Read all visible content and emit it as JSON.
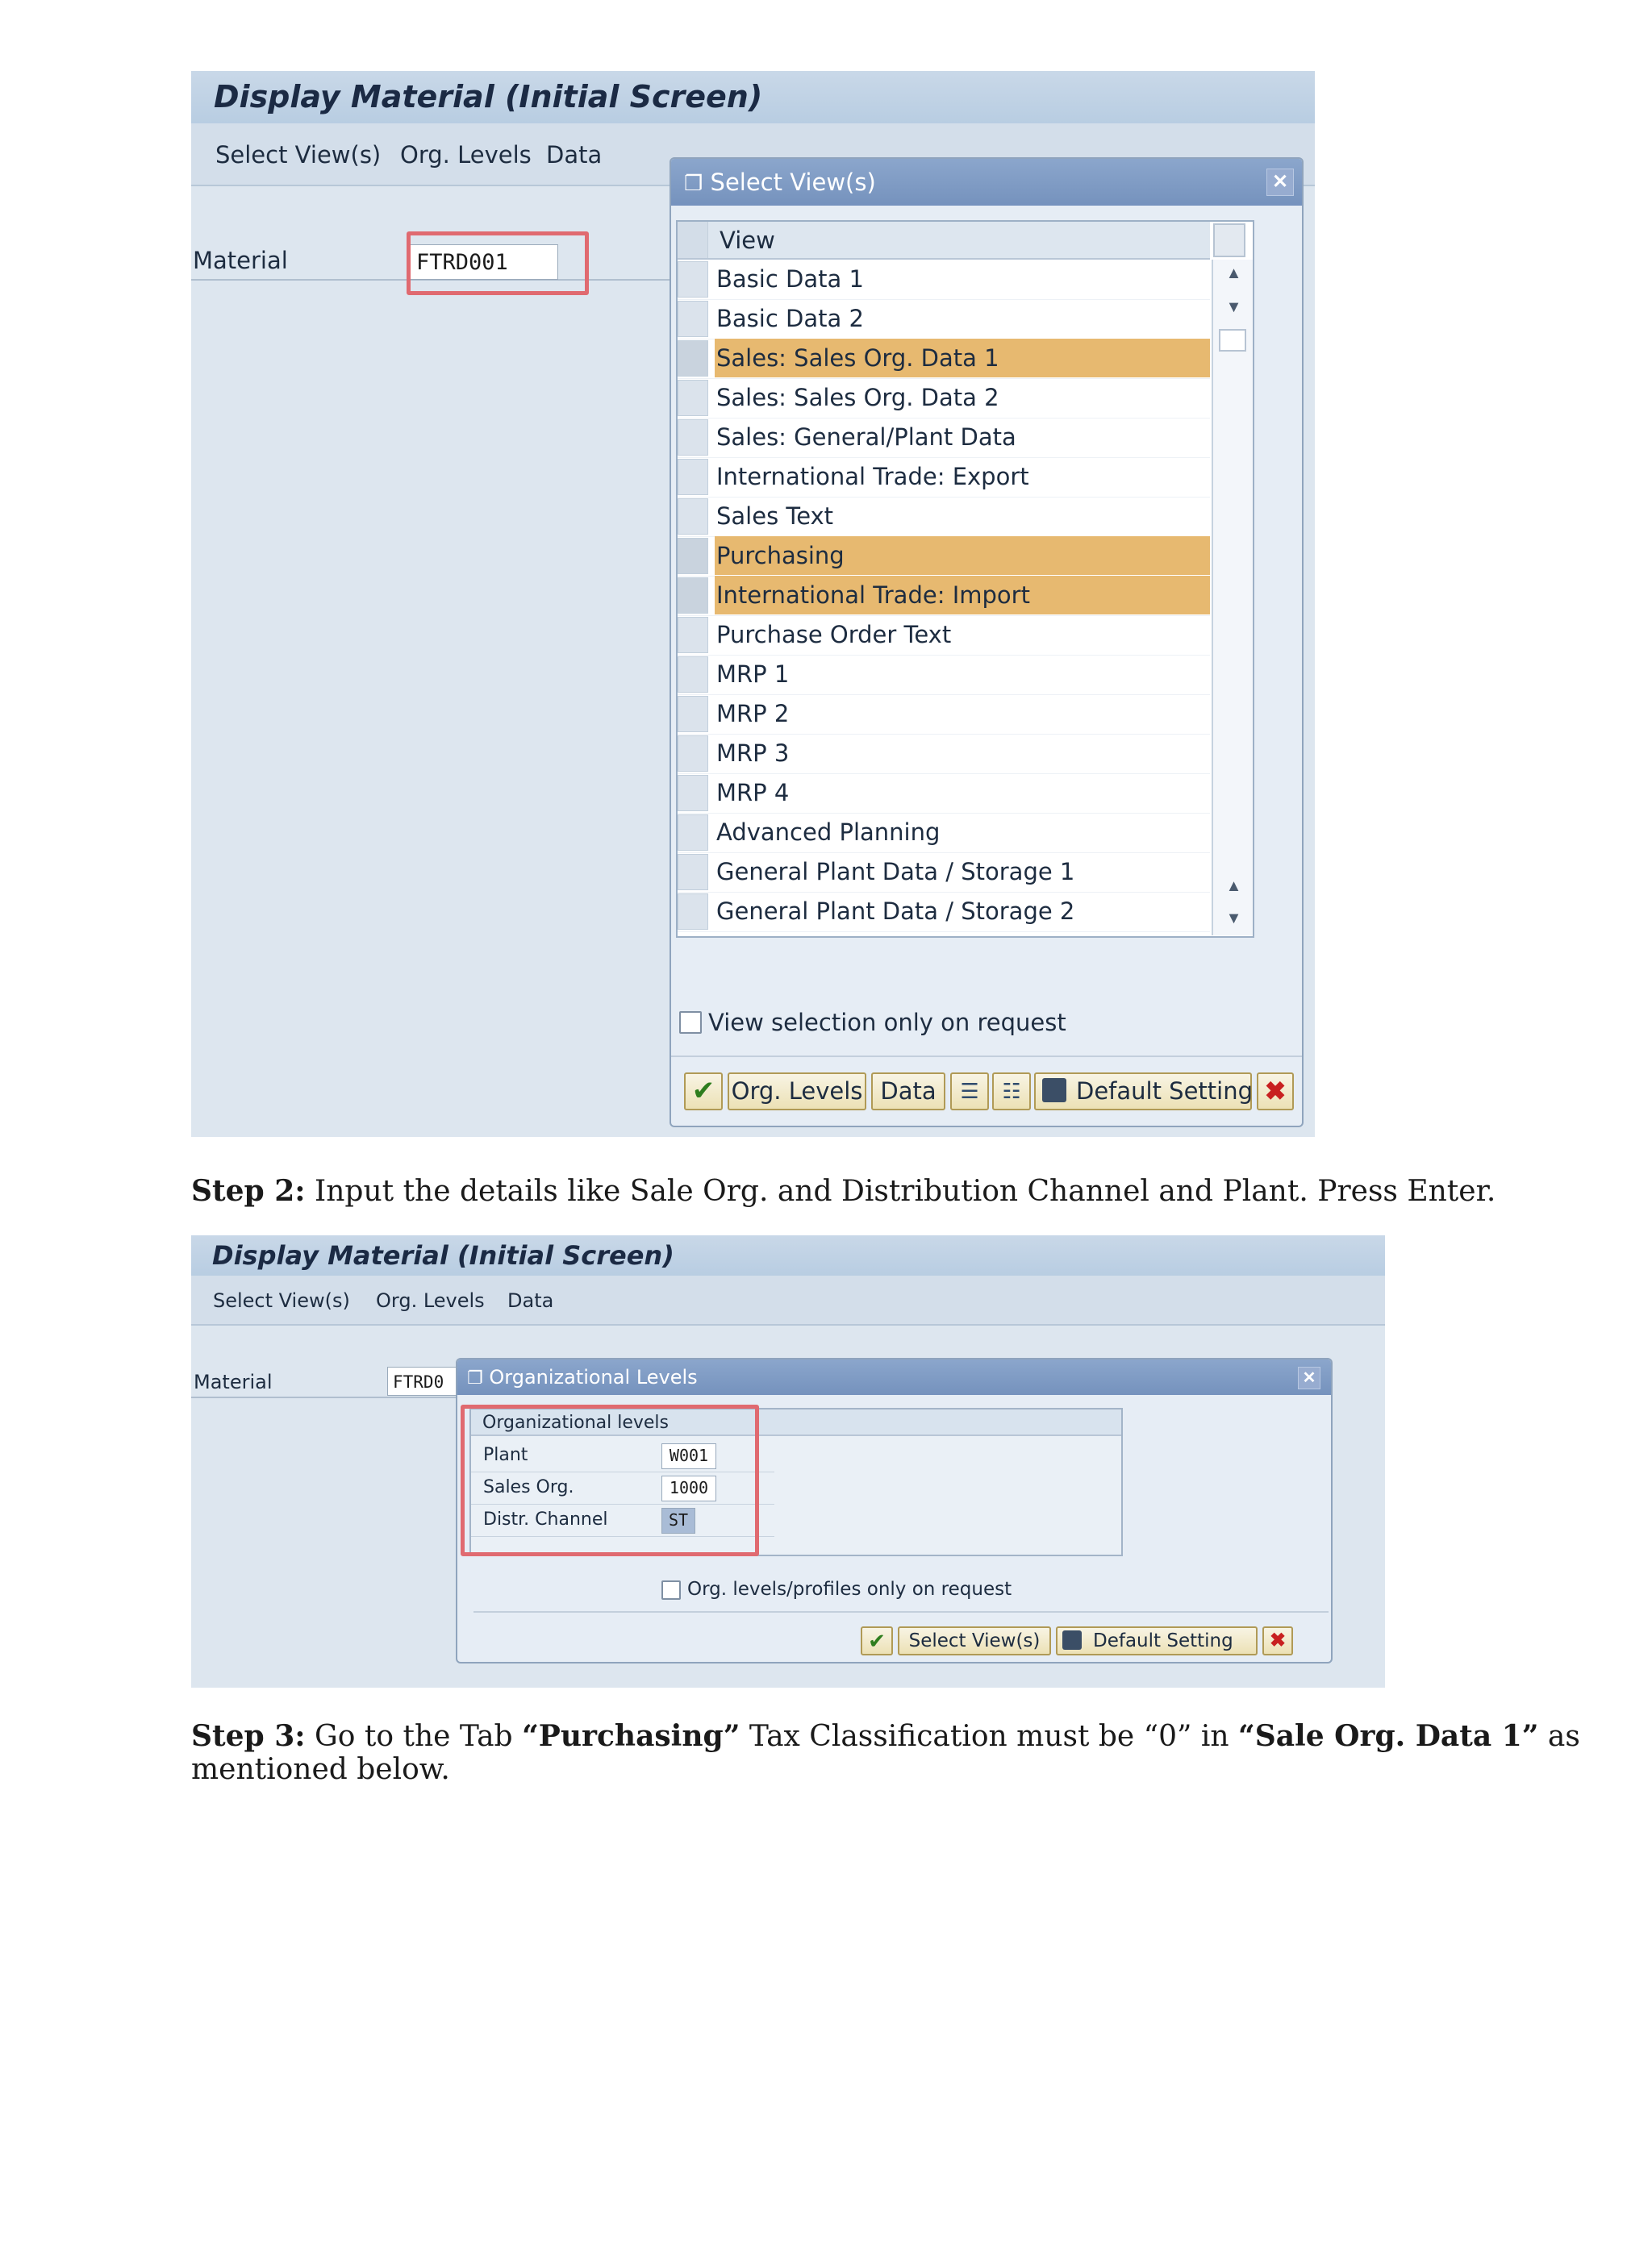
{
  "screenshot1": {
    "title": "Display Material (Initial Screen)",
    "menu": [
      "Select View(s)",
      "Org. Levels",
      "Data"
    ],
    "material_label": "Material",
    "material_value": "FTRD001",
    "dialog": {
      "title": "Select View(s)",
      "column_header": "View",
      "views": [
        {
          "label": "Basic Data 1",
          "selected": false
        },
        {
          "label": "Basic Data 2",
          "selected": false
        },
        {
          "label": "Sales: Sales Org. Data 1",
          "selected": true
        },
        {
          "label": "Sales: Sales Org. Data 2",
          "selected": false
        },
        {
          "label": "Sales: General/Plant Data",
          "selected": false
        },
        {
          "label": "International Trade: Export",
          "selected": false
        },
        {
          "label": "Sales Text",
          "selected": false
        },
        {
          "label": "Purchasing",
          "selected": true
        },
        {
          "label": "International Trade: Import",
          "selected": true
        },
        {
          "label": "Purchase Order Text",
          "selected": false
        },
        {
          "label": "MRP 1",
          "selected": false
        },
        {
          "label": "MRP 2",
          "selected": false
        },
        {
          "label": "MRP 3",
          "selected": false
        },
        {
          "label": "MRP 4",
          "selected": false
        },
        {
          "label": "Advanced Planning",
          "selected": false
        },
        {
          "label": "General Plant Data / Storage 1",
          "selected": false
        },
        {
          "label": "General Plant Data / Storage 2",
          "selected": false
        }
      ],
      "checkbox_label": "View selection only on request",
      "buttons": {
        "org_levels": "Org. Levels",
        "data": "Data",
        "default_setting": "Default Setting"
      }
    }
  },
  "step2": {
    "label": "Step 2:",
    "text": " Input the details like Sale Org. and Distribution Channel and Plant. Press Enter."
  },
  "screenshot2": {
    "title": "Display Material (Initial Screen)",
    "menu": [
      "Select View(s)",
      "Org. Levels",
      "Data"
    ],
    "material_label": "Material",
    "material_value": "FTRD0",
    "dialog": {
      "title": "Organizational Levels",
      "section_header": "Organizational levels",
      "fields": [
        {
          "label": "Plant",
          "value": "W001"
        },
        {
          "label": "Sales Org.",
          "value": "1000"
        },
        {
          "label": "Distr. Channel",
          "value": "ST"
        }
      ],
      "checkbox_label": "Org. levels/profiles only on request",
      "buttons": {
        "select_views": "Select View(s)",
        "default_setting": "Default Setting"
      }
    }
  },
  "step3": {
    "label": "Step 3:",
    "text1": " Go to the Tab ",
    "tab": "“Purchasing”",
    "text2": " Tax Classification must be “0” in ",
    "view": "“Sale Org. Data 1”",
    "text3": " as",
    "line2": "mentioned below."
  },
  "colors": {
    "highlight": "#e7b970",
    "callout_red": "#e06a70",
    "dialog_title": "#7f9bc5"
  }
}
